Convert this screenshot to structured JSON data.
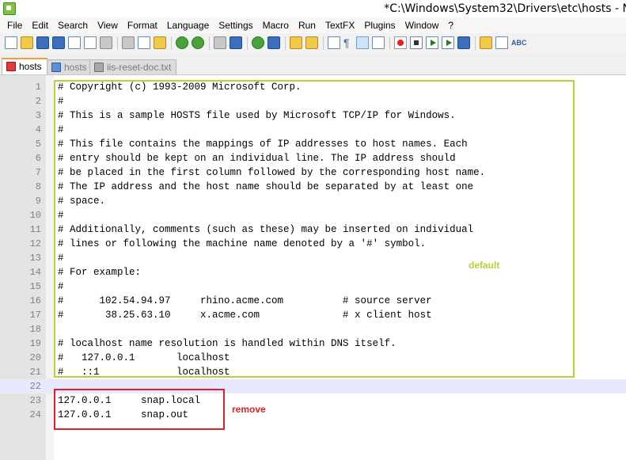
{
  "window": {
    "title": "*C:\\Windows\\System32\\Drivers\\etc\\hosts - N"
  },
  "menu": [
    "File",
    "Edit",
    "Search",
    "View",
    "Format",
    "Language",
    "Settings",
    "Macro",
    "Run",
    "TextFX",
    "Plugins",
    "Window",
    "?"
  ],
  "toolbar": {
    "icons": [
      "new-file-icon",
      "open-file-icon",
      "save-icon",
      "save-all-icon",
      "close-icon",
      "close-all-icon",
      "print-icon",
      "cut-icon",
      "copy-icon",
      "paste-icon",
      "undo-icon",
      "redo-icon",
      "find-icon",
      "replace-icon",
      "zoom-in-icon",
      "zoom-out-icon",
      "sync-vertical-icon",
      "sync-horizontal-icon",
      "word-wrap-icon",
      "show-all-chars-icon",
      "indent-guide-icon",
      "record-macro-icon",
      "stop-macro-icon",
      "play-macro-icon",
      "play-multiple-icon",
      "save-macro-icon",
      "folder-icon",
      "doc-map-icon",
      "spellcheck-icon"
    ],
    "pilcrow_glyph": "¶",
    "spellcheck_glyph": "ABC"
  },
  "tabs": [
    {
      "label": "hosts",
      "active": true
    },
    {
      "label": "hosts",
      "active": false
    },
    {
      "label": "iis-reset-doc.txt",
      "active": false
    }
  ],
  "editor": {
    "lines": [
      {
        "n": "1",
        "text": "# Copyright (c) 1993-2009 Microsoft Corp."
      },
      {
        "n": "2",
        "text": "#"
      },
      {
        "n": "3",
        "text": "# This is a sample HOSTS file used by Microsoft TCP/IP for Windows."
      },
      {
        "n": "4",
        "text": "#"
      },
      {
        "n": "5",
        "text": "# This file contains the mappings of IP addresses to host names. Each"
      },
      {
        "n": "6",
        "text": "# entry should be kept on an individual line. The IP address should"
      },
      {
        "n": "7",
        "text": "# be placed in the first column followed by the corresponding host name."
      },
      {
        "n": "8",
        "text": "# The IP address and the host name should be separated by at least one"
      },
      {
        "n": "9",
        "text": "# space."
      },
      {
        "n": "10",
        "text": "#"
      },
      {
        "n": "11",
        "text": "# Additionally, comments (such as these) may be inserted on individual"
      },
      {
        "n": "12",
        "text": "# lines or following the machine name denoted by a '#' symbol."
      },
      {
        "n": "13",
        "text": "#"
      },
      {
        "n": "14",
        "text": "# For example:"
      },
      {
        "n": "15",
        "text": "#"
      },
      {
        "n": "16",
        "text": "#      102.54.94.97     rhino.acme.com          # source server"
      },
      {
        "n": "17",
        "text": "#       38.25.63.10     x.acme.com              # x client host"
      },
      {
        "n": "18",
        "text": ""
      },
      {
        "n": "19",
        "text": "# localhost name resolution is handled within DNS itself."
      },
      {
        "n": "20",
        "text": "#   127.0.0.1       localhost"
      },
      {
        "n": "21",
        "text": "#   ::1             localhost"
      },
      {
        "n": "22",
        "text": ""
      },
      {
        "n": "23",
        "text": "127.0.0.1     snap.local"
      },
      {
        "n": "24",
        "text": "127.0.0.1     snap.out"
      }
    ],
    "current_line": "22"
  },
  "annotations": {
    "default_label": "default",
    "remove_label": "remove",
    "default_color": "#b5d334",
    "remove_color": "#e0202a"
  }
}
